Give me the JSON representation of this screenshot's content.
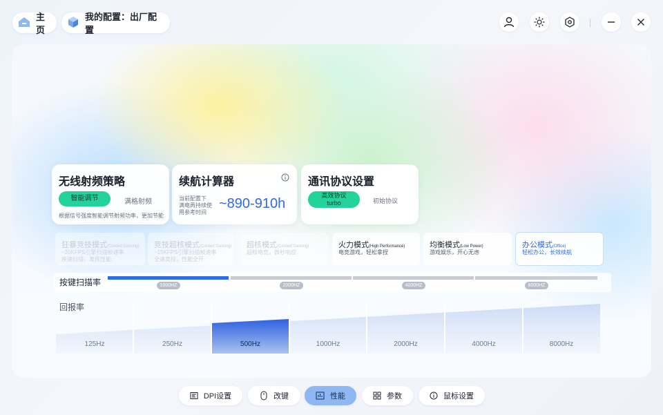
{
  "header": {
    "home_label": "主页",
    "config_label": "我的配置：出厂配置",
    "icons": [
      "user-icon",
      "brightness-icon",
      "settings-hex-icon",
      "minimize-icon",
      "close-icon"
    ]
  },
  "cards": {
    "rf": {
      "title": "无线射频策略",
      "smart_button": "智能调节",
      "full_button": "满格射频",
      "desc": "根据信号强度智能调节射频功率，更加节能"
    },
    "battery": {
      "title": "续航计算器",
      "desc_lines": [
        "当前配置下",
        "满电再持续使",
        "用参考时间"
      ],
      "value": "~890-910h"
    },
    "protocol": {
      "title": "通讯协议设置",
      "efficient_label": "高效协议",
      "efficient_sub": "turbo",
      "initial_label": "初始协议"
    }
  },
  "modes": [
    {
      "title": "狂暴竞技模式",
      "sub": "(Corded Gaming)",
      "desc1": "~20KFPS引擎扫描帧速率",
      "desc2": "疾速扫描，发挥性能"
    },
    {
      "title": "竞技超核模式",
      "sub": "(Corded Gaming)",
      "desc1": "~15KFPS引擎扫描帧速率",
      "desc2": "全速竞技，性能全开"
    },
    {
      "title": "超核模式",
      "sub": "(Corded Gaming)",
      "desc1": "超核电竞，微秒响应",
      "desc2": ""
    },
    {
      "title": "火力模式",
      "sub": "(High Performance)",
      "desc1": "电竞游戏，轻松拿捏",
      "desc2": ""
    },
    {
      "title": "均衡模式",
      "sub": "(Low Power)",
      "desc1": "游戏娱乐，开心无虑",
      "desc2": ""
    },
    {
      "title": "办公模式",
      "sub": "(Office)",
      "desc1": "轻松办公，长效续航",
      "desc2": ""
    }
  ],
  "scan_rate": {
    "label": "按键扫描率",
    "options": [
      "1000HZ",
      "2000HZ",
      "4000HZ",
      "8000HZ"
    ],
    "selected": "1000HZ"
  },
  "report_rate": {
    "label": "回报率",
    "options": [
      "125Hz",
      "250Hz",
      "500Hz",
      "1000Hz",
      "2000Hz",
      "4000Hz",
      "8000Hz"
    ],
    "selected": "500Hz"
  },
  "nav": {
    "items": [
      {
        "label": "DPI设置",
        "icon": "dpi-icon"
      },
      {
        "label": "改键",
        "icon": "mouse-icon"
      },
      {
        "label": "性能",
        "icon": "performance-icon"
      },
      {
        "label": "参数",
        "icon": "grid-icon"
      },
      {
        "label": "鼠标设置",
        "icon": "info-icon"
      }
    ],
    "active": "性能"
  },
  "colors": {
    "accent": "#2e6be6",
    "green": "#22d39a",
    "nav_active": "#8fb8f2"
  }
}
